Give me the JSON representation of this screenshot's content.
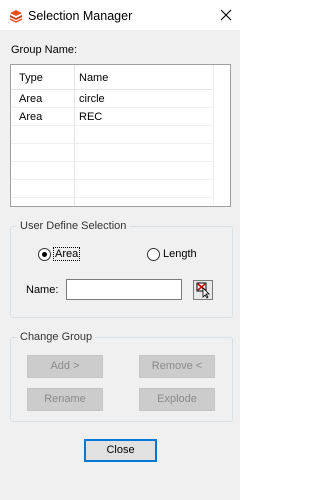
{
  "window": {
    "title": "Selection Manager"
  },
  "group_name_label": "Group Name:",
  "list": {
    "columns": [
      "Type",
      "Name"
    ],
    "rows": [
      {
        "type": "Area",
        "name": "circle"
      },
      {
        "type": "Area",
        "name": "REC"
      }
    ]
  },
  "user_define": {
    "legend": "User Define Selection",
    "options": [
      {
        "label": "Area",
        "selected": true
      },
      {
        "label": "Length",
        "selected": false
      }
    ],
    "name_label": "Name:",
    "name_value": ""
  },
  "change_group": {
    "legend": "Change Group",
    "add_label": "Add >",
    "remove_label": "Remove <",
    "rename_label": "Rename",
    "explode_label": "Explode"
  },
  "close_label": "Close",
  "colors": {
    "accent": "#0078d7",
    "icon_orange": "#e8501c"
  }
}
